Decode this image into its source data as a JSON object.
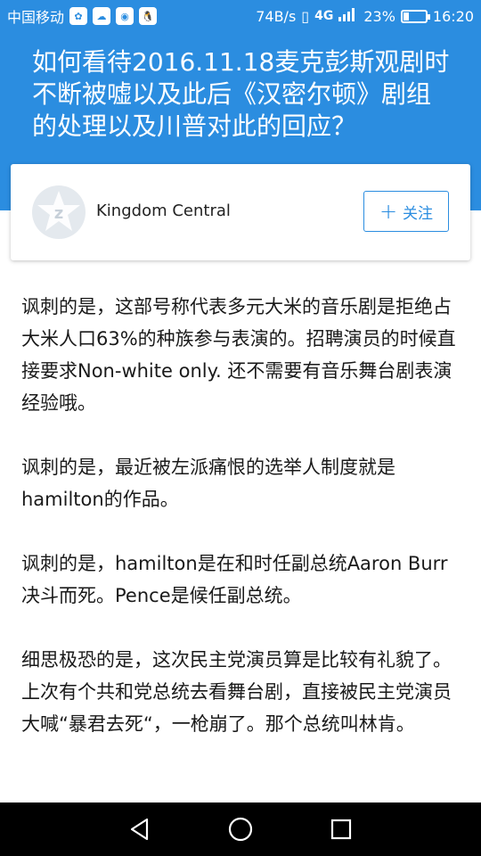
{
  "status_bar": {
    "carrier": "中国移动",
    "speed": "74B/s",
    "network": "4G",
    "battery": "23%",
    "battery_level": 0.23,
    "time": "16:20"
  },
  "question": {
    "title": "如何看待2016.11.18麦克彭斯观剧时不断被嘘以及此后《汉密尔顿》剧组的处理以及川普对此的回应？"
  },
  "author": {
    "name": "Kingdom Central",
    "follow_label": "关注"
  },
  "answer": {
    "paragraphs": [
      "讽刺的是，这部号称代表多元大米的音乐剧是拒绝占大米人口63%的种族参与表演的。招聘演员的时候直接要求Non-white only. 还不需要有音乐舞台剧表演经验哦。",
      "讽刺的是，最近被左派痛恨的选举人制度就是hamilton的作品。",
      "讽刺的是，hamilton是在和时任副总统Aaron Burr决斗而死。Pence是候任副总统。",
      "细思极恐的是，这次民主党演员算是比较有礼貌了。上次有个共和党总统去看舞台剧，直接被民主党演员大喊“暴君去死“，一枪崩了。那个总统叫林肯。"
    ]
  },
  "colors": {
    "accent": "#2b8de0",
    "nav_bg": "#000000"
  },
  "icons": {
    "back": "back-triangle-icon",
    "home": "home-circle-icon",
    "recents": "recents-square-icon"
  }
}
